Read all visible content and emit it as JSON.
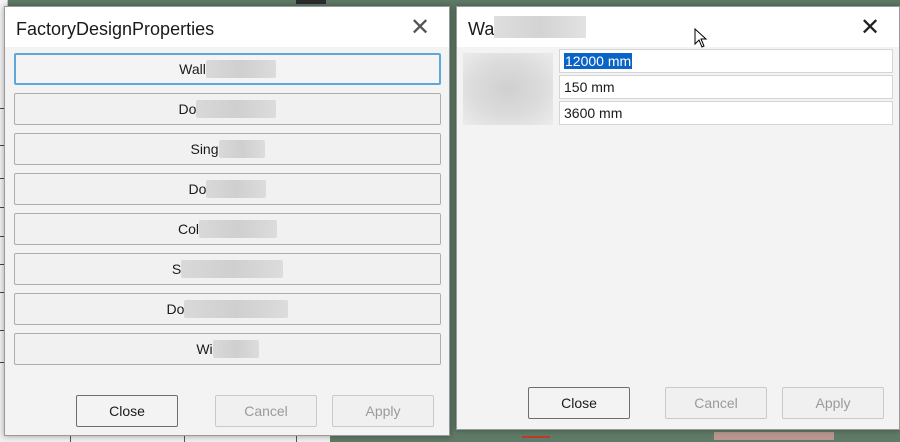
{
  "left_dialog": {
    "title": "FactoryDesignProperties",
    "items": [
      {
        "visible_label": "Wall"
      },
      {
        "visible_label": "Do"
      },
      {
        "visible_label": "Sing"
      },
      {
        "visible_label": "Do"
      },
      {
        "visible_label": "Col"
      },
      {
        "visible_label": "S"
      },
      {
        "visible_label": "Do"
      },
      {
        "visible_label": "Wi"
      }
    ],
    "buttons": {
      "close": "Close",
      "cancel": "Cancel",
      "apply": "Apply"
    }
  },
  "right_dialog": {
    "title_visible": "Wa",
    "fields": [
      {
        "value": "12000 mm",
        "selected": true
      },
      {
        "value": "150 mm",
        "selected": false
      },
      {
        "value": "3600 mm",
        "selected": false
      }
    ],
    "buttons": {
      "close": "Close",
      "cancel": "Cancel",
      "apply": "Apply"
    }
  },
  "icons": {
    "close": "close-icon",
    "cursor": "mouse-cursor-icon"
  },
  "colors": {
    "selection": "#0a64c8",
    "focus_border": "#5fa6d9",
    "background": "#5f7a66"
  }
}
